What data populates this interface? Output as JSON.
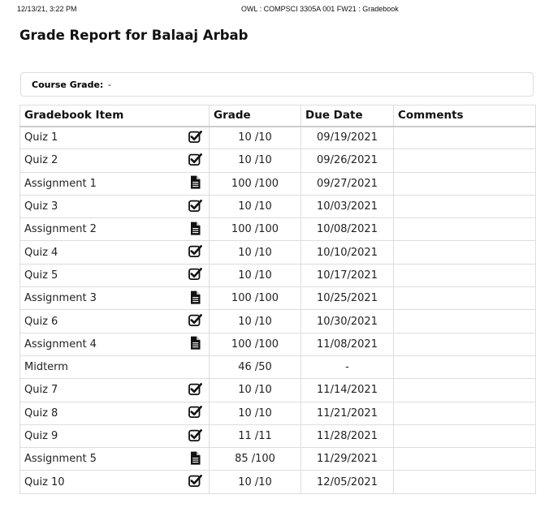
{
  "print_header": {
    "date": "12/13/21, 3:22 PM",
    "title": "OWL : COMPSCI 3305A 001 FW21 : Gradebook"
  },
  "report": {
    "title": "Grade Report for Balaaj Arbab"
  },
  "course_grade": {
    "label": "Course Grade:",
    "value": "-"
  },
  "table": {
    "headers": {
      "item": "Gradebook Item",
      "grade": "Grade",
      "due_date": "Due Date",
      "comments": "Comments"
    },
    "rows": [
      {
        "item": "Quiz 1",
        "icon": "check-square-icon",
        "grade": "10 /10",
        "due": "09/19/2021",
        "comments": ""
      },
      {
        "item": "Quiz 2",
        "icon": "check-square-icon",
        "grade": "10 /10",
        "due": "09/26/2021",
        "comments": ""
      },
      {
        "item": "Assignment 1",
        "icon": "file-text-icon",
        "grade": "100 /100",
        "due": "09/27/2021",
        "comments": ""
      },
      {
        "item": "Quiz 3",
        "icon": "check-square-icon",
        "grade": "10 /10",
        "due": "10/03/2021",
        "comments": ""
      },
      {
        "item": "Assignment 2",
        "icon": "file-text-icon",
        "grade": "100 /100",
        "due": "10/08/2021",
        "comments": ""
      },
      {
        "item": "Quiz 4",
        "icon": "check-square-icon",
        "grade": "10 /10",
        "due": "10/10/2021",
        "comments": ""
      },
      {
        "item": "Quiz 5",
        "icon": "check-square-icon",
        "grade": "10 /10",
        "due": "10/17/2021",
        "comments": ""
      },
      {
        "item": "Assignment 3",
        "icon": "file-text-icon",
        "grade": "100 /100",
        "due": "10/25/2021",
        "comments": ""
      },
      {
        "item": "Quiz 6",
        "icon": "check-square-icon",
        "grade": "10 /10",
        "due": "10/30/2021",
        "comments": ""
      },
      {
        "item": "Assignment 4",
        "icon": "file-text-icon",
        "grade": "100 /100",
        "due": "11/08/2021",
        "comments": ""
      },
      {
        "item": "Midterm",
        "icon": "",
        "grade": "46 /50",
        "due": "-",
        "comments": ""
      },
      {
        "item": "Quiz 7",
        "icon": "check-square-icon",
        "grade": "10 /10",
        "due": "11/14/2021",
        "comments": ""
      },
      {
        "item": "Quiz 8",
        "icon": "check-square-icon",
        "grade": "10 /10",
        "due": "11/21/2021",
        "comments": ""
      },
      {
        "item": "Quiz 9",
        "icon": "check-square-icon",
        "grade": "11 /11",
        "due": "11/28/2021",
        "comments": ""
      },
      {
        "item": "Assignment 5",
        "icon": "file-text-icon",
        "grade": "85 /100",
        "due": "11/29/2021",
        "comments": ""
      },
      {
        "item": "Quiz 10",
        "icon": "check-square-icon",
        "grade": "10 /10",
        "due": "12/05/2021",
        "comments": ""
      }
    ]
  }
}
